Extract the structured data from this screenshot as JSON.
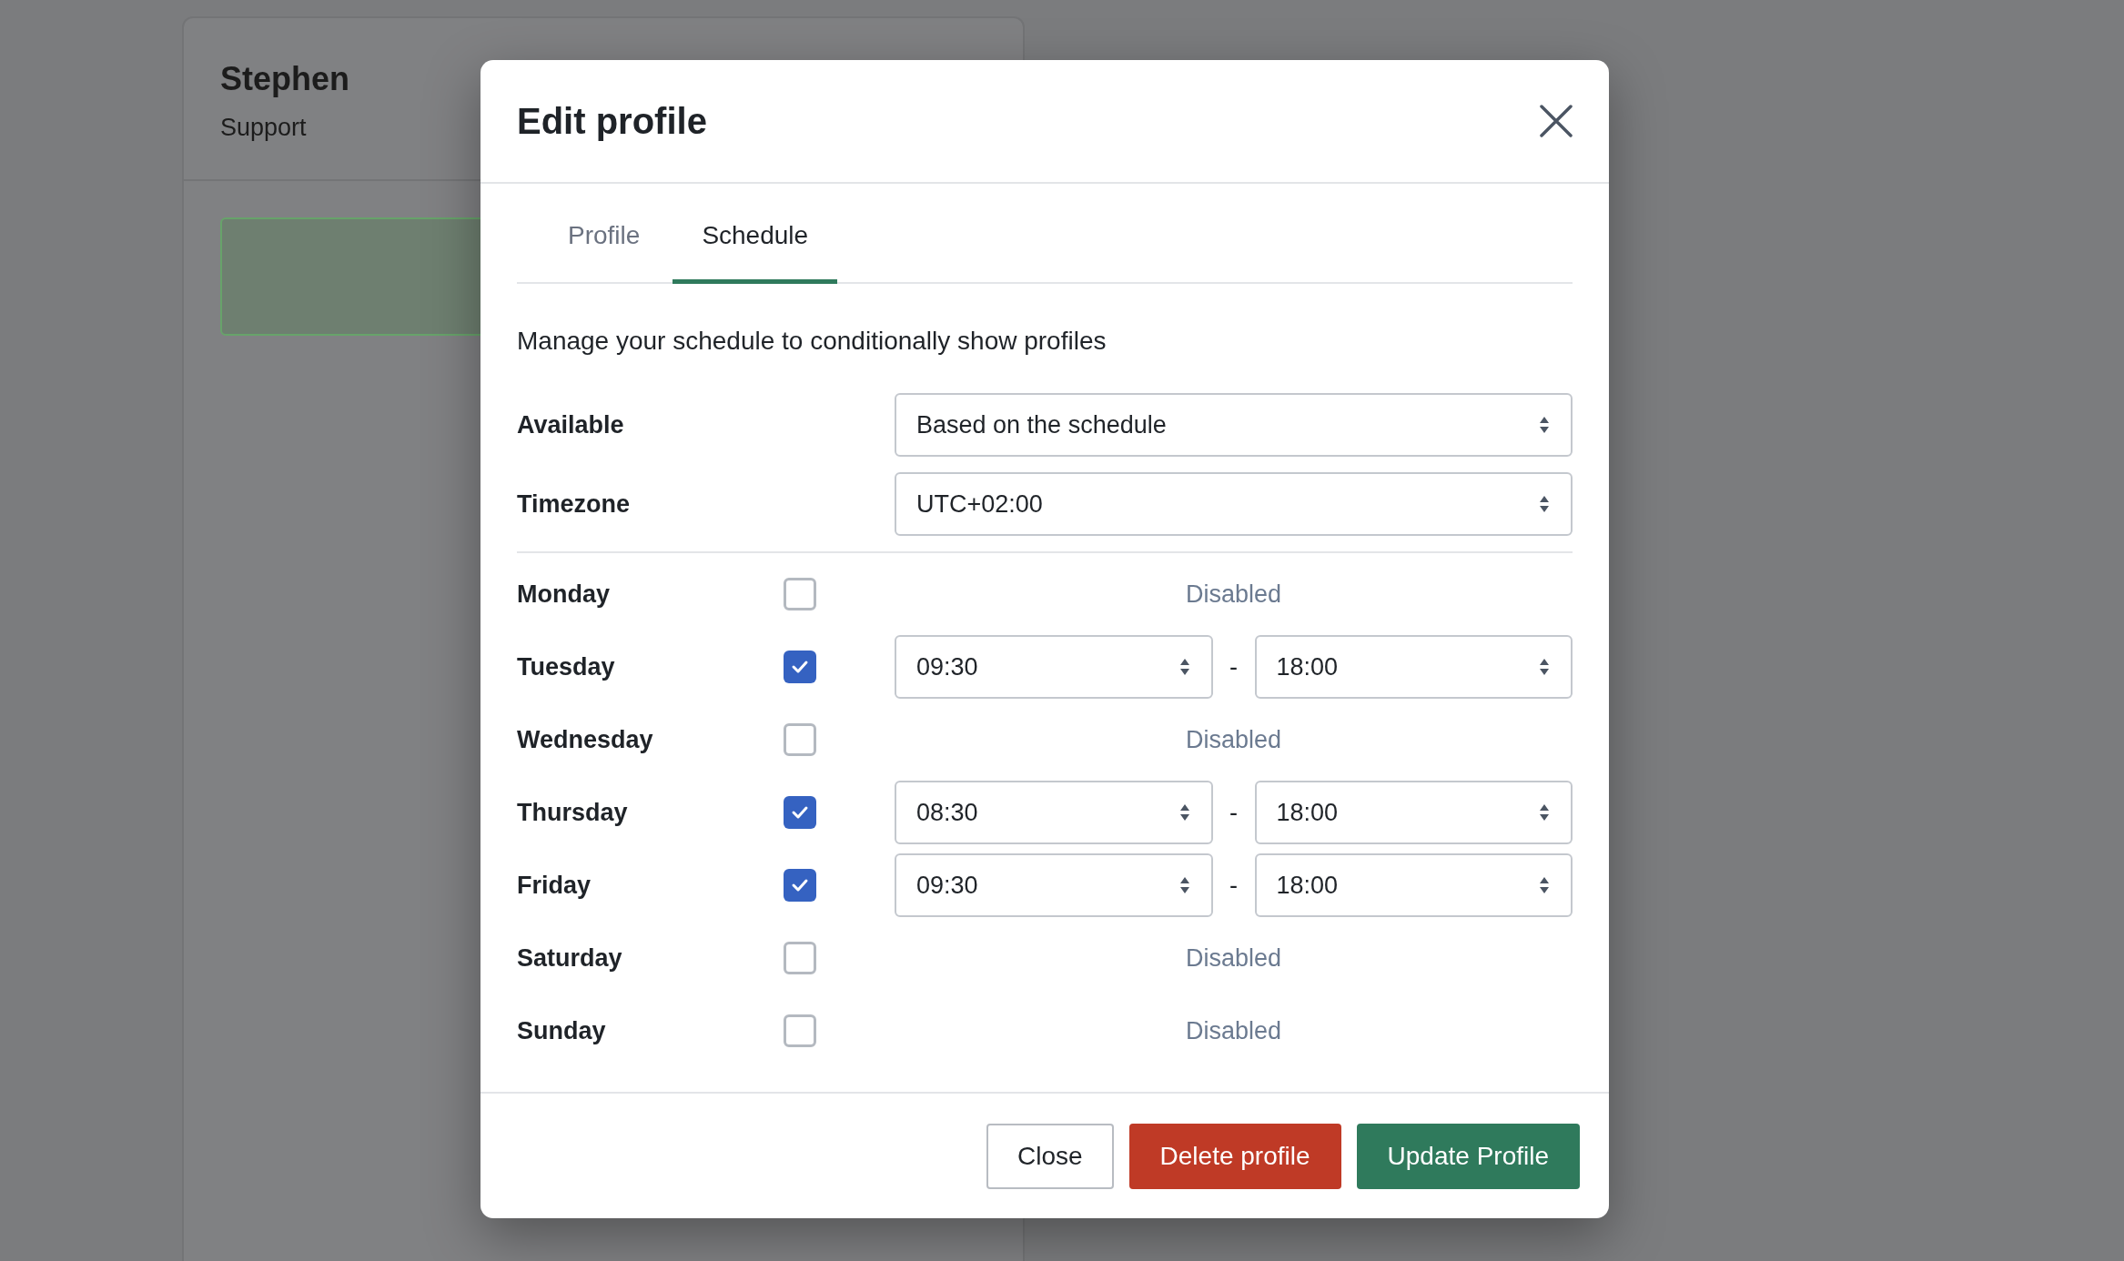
{
  "background_card": {
    "name": "Stephen",
    "role": "Support"
  },
  "dialog": {
    "title": "Edit profile",
    "tabs": [
      {
        "label": "Profile",
        "selected": false
      },
      {
        "label": "Schedule",
        "selected": true
      }
    ],
    "description": "Manage your schedule to conditionally show profiles",
    "fields": [
      {
        "label": "Available",
        "value": "Based on the schedule"
      },
      {
        "label": "Timezone",
        "value": "UTC+02:00"
      }
    ],
    "days": [
      {
        "name": "Monday",
        "checked": false,
        "status": "Disabled"
      },
      {
        "name": "Tuesday",
        "checked": true,
        "start": "09:30",
        "separator": "-",
        "end": "18:00"
      },
      {
        "name": "Wednesday",
        "checked": false,
        "status": "Disabled"
      },
      {
        "name": "Thursday",
        "checked": true,
        "start": "08:30",
        "separator": "-",
        "end": "18:00"
      },
      {
        "name": "Friday",
        "checked": true,
        "start": "09:30",
        "separator": "-",
        "end": "18:00"
      },
      {
        "name": "Saturday",
        "checked": false,
        "status": "Disabled"
      },
      {
        "name": "Sunday",
        "checked": false,
        "status": "Disabled"
      }
    ],
    "buttons": [
      {
        "label": "Close",
        "kind": "secondary"
      },
      {
        "label": "Delete profile",
        "kind": "danger"
      },
      {
        "label": "Update Profile",
        "kind": "primary"
      }
    ]
  }
}
